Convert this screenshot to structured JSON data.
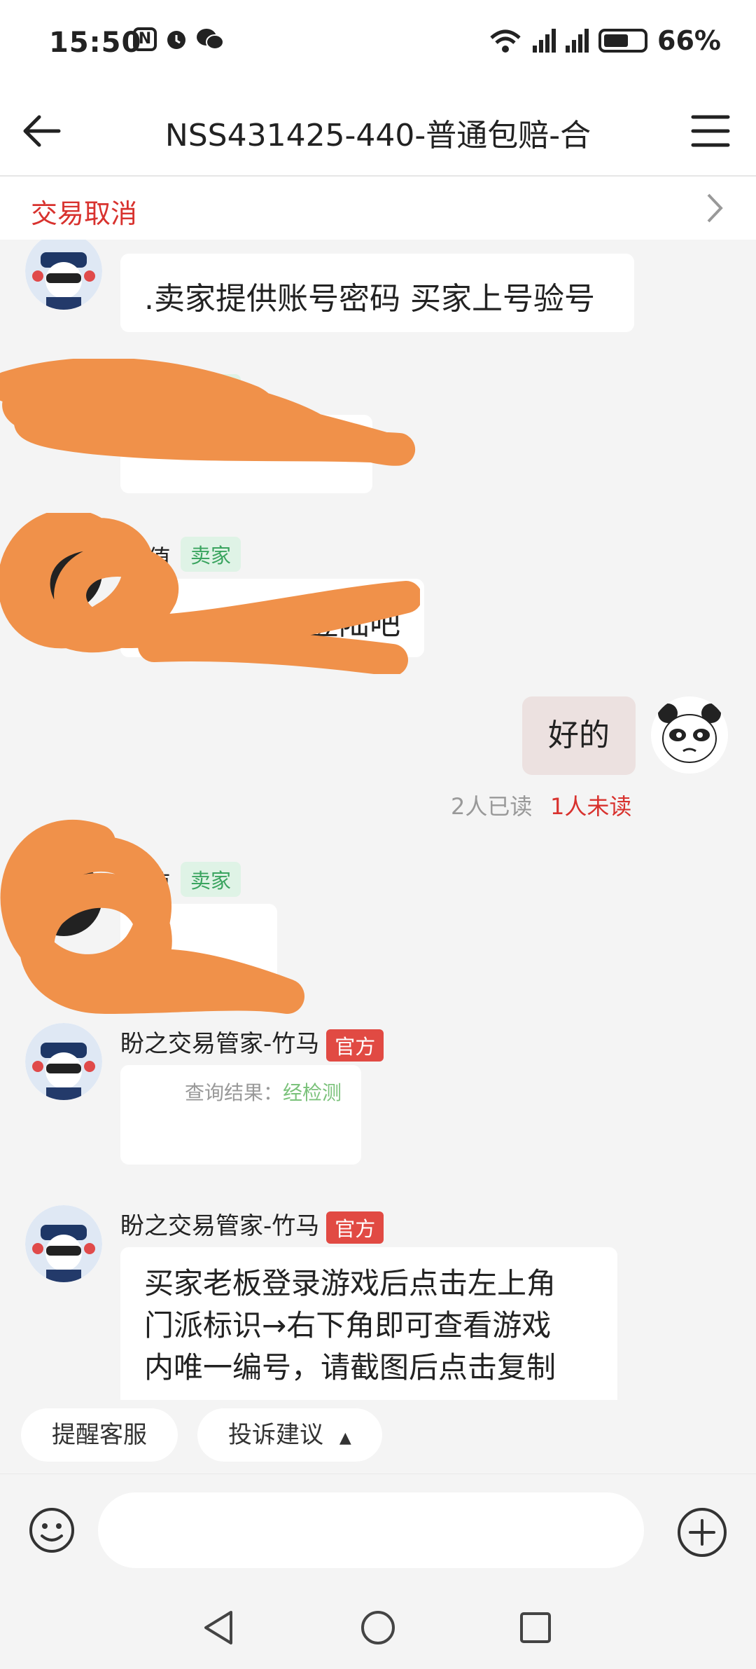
{
  "status_bar": {
    "time": "15:50",
    "left_icons": [
      "nfc-icon",
      "alarm-icon",
      "wechat-icon"
    ],
    "wifi_label": "6",
    "sim1_label": "5G",
    "sim2_label": "5G",
    "battery": "66%"
  },
  "header": {
    "title": "NSS431425-440-普通包赔-合"
  },
  "cancel_bar": {
    "label": "交易取消"
  },
  "messages": {
    "m1": {
      "text": ".卖家提供账号密码 买家上号验号"
    },
    "m2": {
      "tag": "卖家"
    },
    "m3": {
      "name_fragment": "值",
      "tag": "卖家",
      "text_fragment": "的登陆吧"
    },
    "m4": {
      "text": "好的",
      "read": "2人已读",
      "unread": "1人未读"
    },
    "m5": {
      "name_fragment": "值",
      "tag": "卖家"
    },
    "m6": {
      "sender": "盼之交易管家-竹马",
      "tag": "官方",
      "label": "查询结果：",
      "value": "经检测"
    },
    "m7": {
      "sender": "盼之交易管家-竹马",
      "tag": "官方",
      "lines": [
        "买家老板登录游戏后点击左上角",
        "门派标识→右下角即可查看游戏",
        "内唯一编号，请截图后点击复制"
      ]
    }
  },
  "quick_replies": {
    "remind": "提醒客服",
    "complaint": "投诉建议"
  },
  "colors": {
    "accent_red": "#d8322e",
    "official_tag": "#e14a43",
    "seller_tag_bg": "#dff3e6",
    "seller_tag_text": "#3aa45f",
    "redaction": "#f0914a",
    "my_bubble": "#ece1e0"
  }
}
